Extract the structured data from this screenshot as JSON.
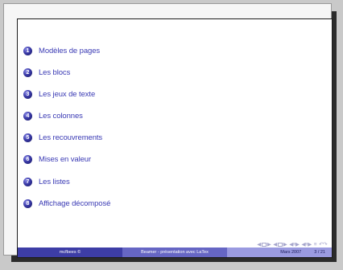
{
  "toc": {
    "items": [
      {
        "number": "1",
        "label": "Modèles de pages"
      },
      {
        "number": "2",
        "label": "Les blocs"
      },
      {
        "number": "3",
        "label": "Les jeux de texte"
      },
      {
        "number": "4",
        "label": "Les colonnes"
      },
      {
        "number": "5",
        "label": "Les recouvrements"
      },
      {
        "number": "6",
        "label": "Mises en valeur"
      },
      {
        "number": "7",
        "label": "Les listes"
      },
      {
        "number": "8",
        "label": "Affichage décomposé"
      }
    ]
  },
  "footer": {
    "author": "mcfbees ©",
    "title": "Beamer - présentation avec LaTex",
    "date": "Mars 2007",
    "page": "3 / 21"
  },
  "colors": {
    "accent": "#3a3ab4",
    "footer_dark": "#3d3da6",
    "footer_mid": "#6666c4",
    "footer_light": "#9a9ae0"
  }
}
